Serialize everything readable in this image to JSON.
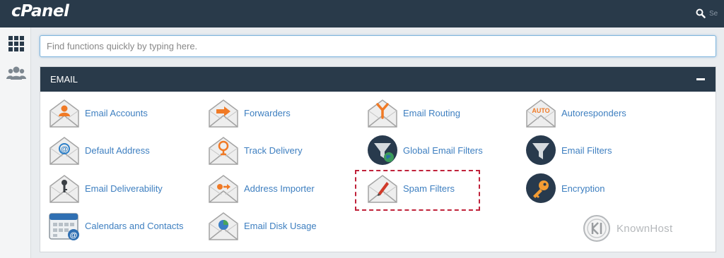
{
  "app": {
    "logo_text": "cPanel",
    "search_hint": "Se",
    "search_icon": "magnifier-icon"
  },
  "sidebar": {
    "items": [
      {
        "icon": "grid-apps-icon"
      },
      {
        "icon": "users-icon"
      }
    ]
  },
  "search": {
    "placeholder": "Find functions quickly by typing here."
  },
  "section": {
    "title": "EMAIL",
    "collapse_icon": "minus-icon"
  },
  "items": [
    {
      "label": "Email Accounts",
      "icon": "email-accounts-icon"
    },
    {
      "label": "Forwarders",
      "icon": "forwarders-icon"
    },
    {
      "label": "Email Routing",
      "icon": "email-routing-icon"
    },
    {
      "label": "Autoresponders",
      "icon": "autoresponders-icon"
    },
    {
      "label": "Default Address",
      "icon": "default-address-icon"
    },
    {
      "label": "Track Delivery",
      "icon": "track-delivery-icon"
    },
    {
      "label": "Global Email Filters",
      "icon": "global-email-filters-icon"
    },
    {
      "label": "Email Filters",
      "icon": "email-filters-icon"
    },
    {
      "label": "Email Deliverability",
      "icon": "email-deliverability-icon"
    },
    {
      "label": "Address Importer",
      "icon": "address-importer-icon"
    },
    {
      "label": "Spam Filters",
      "icon": "spam-filters-icon"
    },
    {
      "label": "Encryption",
      "icon": "encryption-key-icon"
    },
    {
      "label": "Calendars and Contacts",
      "icon": "calendar-icon"
    },
    {
      "label": "Email Disk Usage",
      "icon": "disk-usage-pie-icon"
    }
  ],
  "watermark": {
    "text": "KnownHost"
  },
  "colors": {
    "header": "#293a4a",
    "link": "#3e7fc0",
    "accent_orange": "#f07a26",
    "highlight_border": "#c0223a"
  }
}
